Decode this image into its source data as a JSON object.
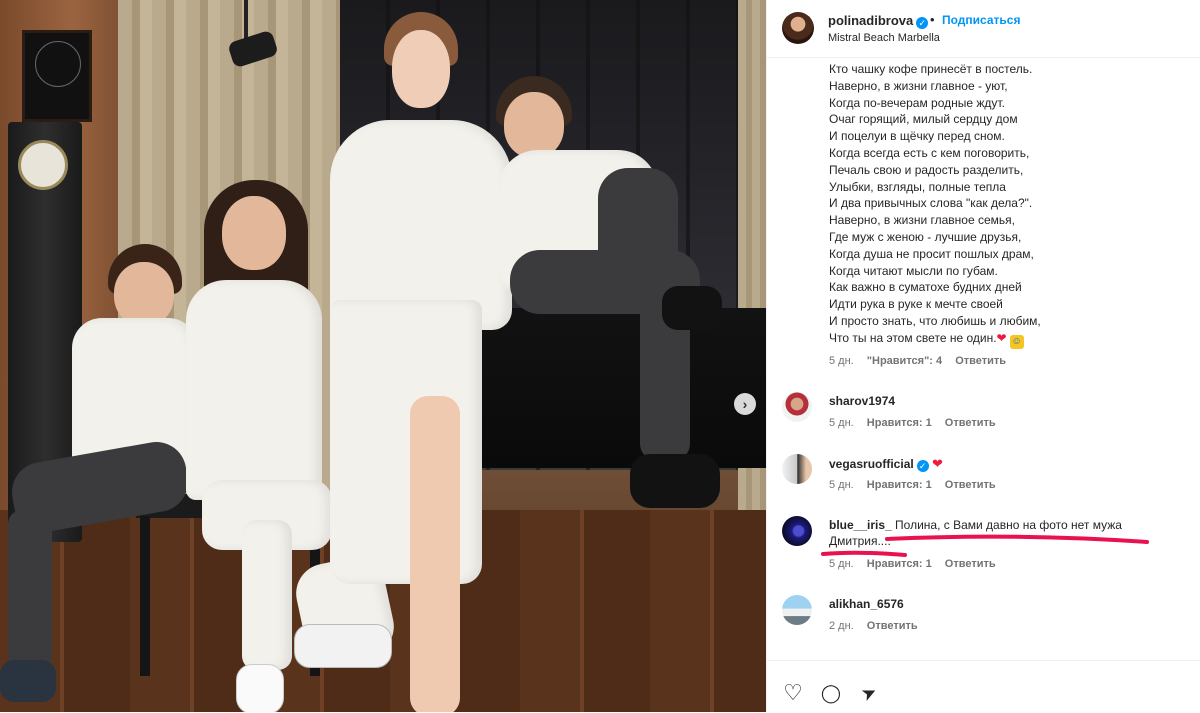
{
  "post": {
    "username": "polinadibrova",
    "verified_mark": "✓",
    "separator": "•",
    "follow_label": "Подписаться",
    "location": "Mistral Beach Marbella"
  },
  "caption": {
    "lines": [
      "Кто чашку кофе принесёт в постель.",
      "Наверно, в жизни главное - уют,",
      "Когда по-вечерам родные ждут.",
      "Очаг горящий, милый сердцу дом",
      "И поцелуи в щёчку перед сном.",
      "Когда всегда есть с кем поговорить,",
      "Печаль свою и радость разделить,",
      "Улыбки, взгляды, полные тепла",
      "И два привычных слова \"как дела?\".",
      "Наверно, в жизни главное семья,",
      "Где муж с женою - лучшие друзья,",
      "Когда душа не просит пошлых драм,",
      "Когда читают мысли по губам.",
      "Как важно в суматохе будних дней",
      "Идти рука в руке к мечте своей",
      "И просто знать, что любишь и любим,",
      "Что ты на этом свете не один."
    ],
    "emoji_heart": "❤",
    "emoji_face": "☺",
    "time": "5 дн.",
    "likes": "\"Нравится\": 4",
    "reply": "Ответить"
  },
  "comments": [
    {
      "username": "sharov1974",
      "text": "",
      "text2": "",
      "time": "5 дн.",
      "likes": "Нравится: 1",
      "reply": "Ответить",
      "verified": false,
      "heart": ""
    },
    {
      "username": "vegasruofficial",
      "text": "",
      "text2": "",
      "time": "5 дн.",
      "likes": "Нравится: 1",
      "reply": "Ответить",
      "verified": true,
      "heart": "❤"
    },
    {
      "username": "blue__iris_",
      "text": "Полина, с Вами давно на фото нет мужа",
      "text2": "Дмитрия....",
      "time": "5 дн.",
      "likes": "Нравится: 1",
      "reply": "Ответить",
      "verified": false,
      "heart": ""
    },
    {
      "username": "alikhan_6576",
      "text": "",
      "text2": "",
      "time": "2 дн.",
      "likes": "",
      "reply": "Ответить",
      "verified": false,
      "heart": ""
    }
  ],
  "icons": {
    "like": "heart-outline-icon",
    "comment": "comment-bubble-icon",
    "share": "paper-plane-icon",
    "next": "chevron-right-icon"
  },
  "actions": {
    "like_glyph": "♡",
    "comment_glyph": "◯",
    "share_glyph": "➤",
    "next_glyph": "›"
  },
  "colors": {
    "accent": "#0095f6",
    "heart": "#ed1c3c",
    "annotation": "#e8124f"
  }
}
